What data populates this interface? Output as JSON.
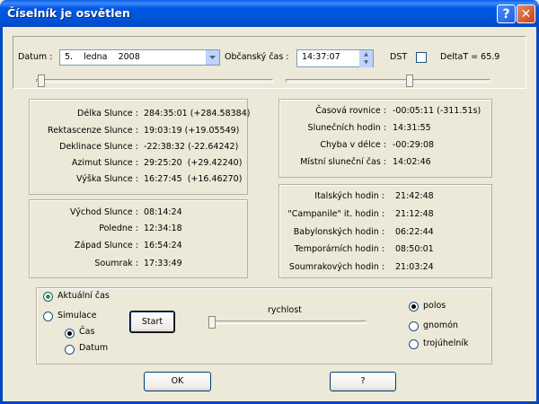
{
  "window": {
    "title": "Číselník je osvětlen",
    "help_label": "?",
    "close_label": "✕"
  },
  "top": {
    "datum_label": "Datum :",
    "datum_value": "5.    ledna    2008",
    "obc_label": "Občanský čas :",
    "time_value": "14:37:07",
    "dst_label": "DST",
    "deltat_label": "DeltaT = 65.9"
  },
  "sun_position": [
    {
      "label": "Délka Slunce :",
      "value": "284:35:01 (+284.58384)"
    },
    {
      "label": "Rektascenze Slunce :",
      "value": "19:03:19 (+19.05549)"
    },
    {
      "label": "Deklinace Slunce :",
      "value": "-22:38:32 (-22.64242)"
    },
    {
      "label": "Azimut Slunce :",
      "value": "29:25:20  (+29.42240)"
    },
    {
      "label": "Výška Slunce :",
      "value": "16:27:45  (+16.46270)"
    }
  ],
  "sun_times": [
    {
      "label": "Východ Slunce :",
      "value": "08:14:24"
    },
    {
      "label": "Poledne :",
      "value": "12:34:18"
    },
    {
      "label": "Západ Slunce :",
      "value": "16:54:24"
    },
    {
      "label": "Soumrak :",
      "value": "17:33:49"
    }
  ],
  "time_eq": [
    {
      "label": "Časová rovnice :",
      "value": "-00:05:11 (-311.51s)"
    },
    {
      "label": "Slunečních hodin :",
      "value": "14:31:55"
    },
    {
      "label": "Chyba v délce :",
      "value": "-00:29:08"
    },
    {
      "label": "Místní sluneční čas :",
      "value": "14:02:46"
    }
  ],
  "hours": [
    {
      "label": "Italských hodin :",
      "value": "21:42:48"
    },
    {
      "label": "\"Campanile\" it. hodin :",
      "value": "21:12:48"
    },
    {
      "label": "Babylonských hodin :",
      "value": "06:22:44"
    },
    {
      "label": "Temporárních hodin :",
      "value": "08:50:01"
    },
    {
      "label": "Soumrakových hodin :",
      "value": "21:03:24"
    }
  ],
  "controls": {
    "aktualni_label": "Aktuální čas",
    "simulace_label": "Simulace",
    "cas_label": "Čas",
    "datum_label": "Datum",
    "start_label": "Start",
    "rychlost_label": "rychlost",
    "polos_label": "polos",
    "gnomon_label": "gnomón",
    "trojuhelnik_label": "trojúhelník"
  },
  "footer": {
    "ok_label": "OK",
    "help_label": "?"
  },
  "colors": {
    "titlebar": "#0055D8",
    "face": "#ECE9D8",
    "radio_on": "#21A121"
  }
}
